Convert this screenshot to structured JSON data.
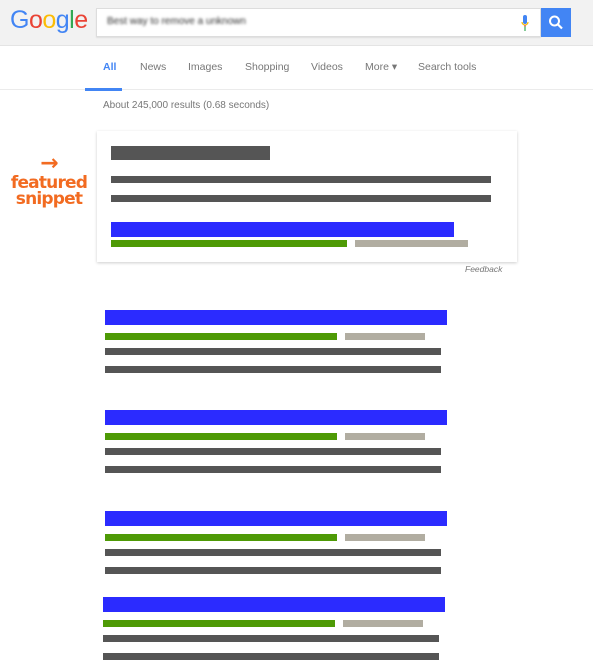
{
  "header": {
    "logo": "Google",
    "logo_colors": [
      "#4285f4",
      "#ea4335",
      "#fbbc05",
      "#4285f4",
      "#34a853",
      "#ea4335"
    ],
    "query": "Best way to remove a unknown",
    "accent": "#4285f4"
  },
  "tabs": [
    {
      "label": "All",
      "active": true
    },
    {
      "label": "News"
    },
    {
      "label": "Images"
    },
    {
      "label": "Shopping"
    },
    {
      "label": "Videos"
    },
    {
      "label": "More ▾"
    },
    {
      "label": "Search tools"
    }
  ],
  "stats": "About 245,000 results (0.68 seconds)",
  "annotation": {
    "arrow": "→",
    "label": "featured snippet",
    "color": "#f26b21"
  },
  "snippet": {
    "feedback": "Feedback"
  },
  "results_count": 4
}
